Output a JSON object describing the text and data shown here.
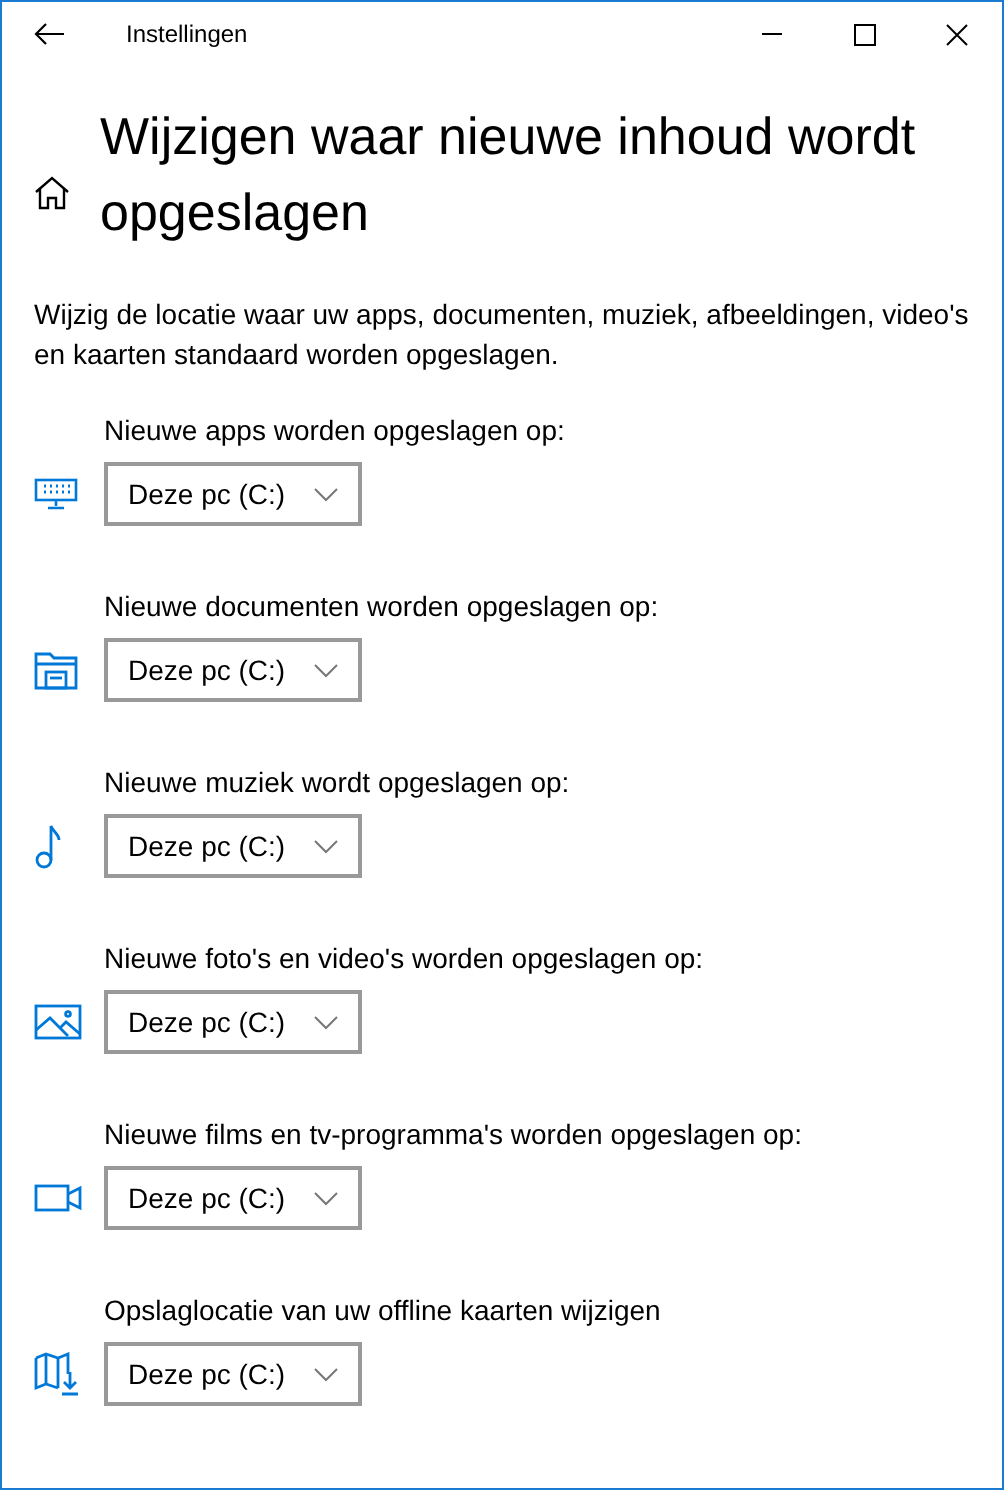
{
  "window": {
    "title": "Instellingen"
  },
  "heading": "Wijzigen waar nieuwe inhoud wordt opgeslagen",
  "description": "Wijzig de locatie waar uw apps, documenten, muziek, afbeeldingen, video's en kaarten standaard worden opgeslagen.",
  "settings": [
    {
      "kind": "apps",
      "label": "Nieuwe apps worden opgeslagen op:",
      "value": "Deze pc (C:)"
    },
    {
      "kind": "documents",
      "label": "Nieuwe documenten worden opgeslagen op:",
      "value": "Deze pc (C:)"
    },
    {
      "kind": "music",
      "label": "Nieuwe muziek wordt opgeslagen op:",
      "value": "Deze pc (C:)"
    },
    {
      "kind": "photos",
      "label": "Nieuwe foto's en video's worden opgeslagen op:",
      "value": "Deze pc (C:)"
    },
    {
      "kind": "movies",
      "label": "Nieuwe films en tv-programma's worden opgeslagen op:",
      "value": "Deze pc (C:)"
    },
    {
      "kind": "maps",
      "label": "Opslaglocatie van uw offline kaarten wijzigen",
      "value": "Deze pc (C:)"
    }
  ]
}
